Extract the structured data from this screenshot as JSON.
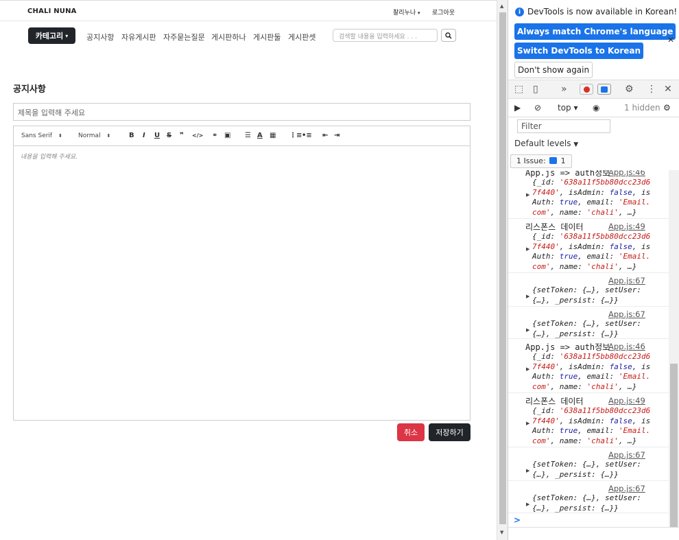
{
  "page": {
    "brand": "CHALI NUNA",
    "user_menu": "찰리누나",
    "logout": "로그아웃",
    "category_button": "카테고리",
    "nav": [
      "공지사항",
      "자유게시판",
      "자주묻는질문",
      "게시판하나",
      "게시판둘",
      "게시판셋"
    ],
    "search_placeholder": "검색할 내용을 입력하세요 . . .",
    "title": "공지사항",
    "title_placeholder": "제목을 입력해 주세요",
    "editor": {
      "font": "Sans Serif",
      "size": "Normal",
      "body_placeholder": "내용을 입력해 주세요."
    },
    "cancel": "취소",
    "save": "저장하기"
  },
  "devtools": {
    "info": "DevTools is now available in Korean!",
    "match_language": "Always match Chrome's language",
    "switch_language": "Switch DevTools to Korean",
    "dont_show": "Don't show again",
    "context": "top",
    "hidden": "1 hidden",
    "filter_placeholder": "Filter",
    "levels": "Default levels",
    "issues_label": "1 Issue:",
    "issues_count": "1",
    "entries": [
      {
        "msg": "App.js => auth정보",
        "src": "App.js:46",
        "lines": [
          [
            "",
            "{_id: "
          ],
          [
            "str",
            "'638a11f5bb80dcc23d6"
          ],
          [
            "",
            "\n"
          ],
          [
            "str",
            "7f440'"
          ],
          [
            "",
            " , isAdmin: "
          ],
          [
            "bool",
            "false"
          ],
          [
            "",
            ", is\nAuth: "
          ],
          [
            "bool",
            "true"
          ],
          [
            "",
            ", email: "
          ],
          [
            "str",
            "'Email."
          ],
          [
            "",
            "\n"
          ],
          [
            "str",
            "com'"
          ],
          [
            "",
            ", name: "
          ],
          [
            "str",
            "'chali'"
          ],
          [
            "",
            ", …}"
          ]
        ]
      },
      {
        "msg": "리스폰스 데이터",
        "src": "App.js:49",
        "lines": []
      },
      {
        "msg": "",
        "src": "App.js:67",
        "lines": []
      },
      {
        "msg": "",
        "src": "App.js:67",
        "lines": []
      },
      {
        "msg": "App.js => auth정보",
        "src": "App.js:46",
        "lines": []
      },
      {
        "msg": "리스폰스 데이터",
        "src": "App.js:49",
        "lines": []
      },
      {
        "msg": "",
        "src": "App.js:67",
        "lines": []
      },
      {
        "msg": "",
        "src": "App.js:67",
        "lines": []
      }
    ],
    "auth_object": "{_id: '638a11f5bb80dcc23d67f440', isAdmin: false, isAuth: true, email: 'Email.com', name: 'chali', …}",
    "token_object": "{setToken: {…}, setUser: {…}, _persist: {…}}",
    "prompt": ">"
  }
}
